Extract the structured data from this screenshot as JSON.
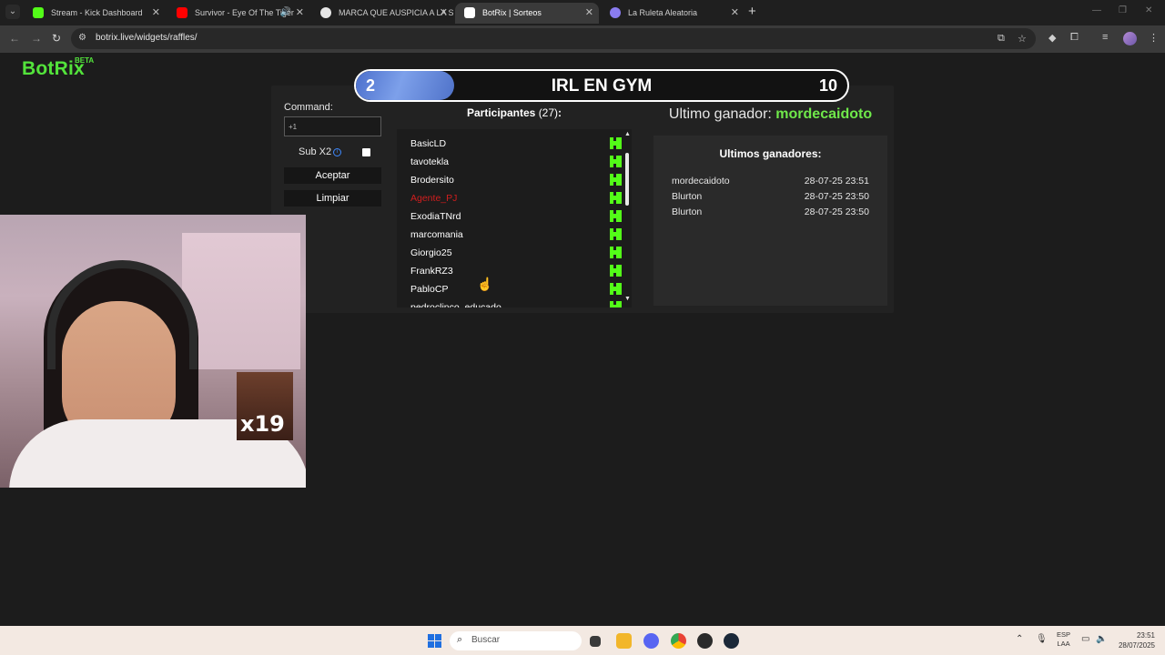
{
  "browser": {
    "tabs": [
      {
        "title": "Stream - Kick Dashboard",
        "favicon_color": "#53fc18",
        "active": false
      },
      {
        "title": "Survivor - Eye Of The Tiger",
        "favicon_color": "#ff0000",
        "active": false
      },
      {
        "title": "MARCA QUE AUSPICIA A LA SE",
        "favicon_color": "#e6e6e6",
        "active": false
      },
      {
        "title": "BotRix | Sorteos",
        "favicon_color": "#ffffff",
        "active": true
      },
      {
        "title": "La Ruleta Aleatoria",
        "favicon_color": "#8a7cf0",
        "active": false
      }
    ],
    "url": "botrix.live/widgets/raffles/"
  },
  "app": {
    "logo": "BotRix",
    "logo_badge": "BETA"
  },
  "raffle": {
    "progress_min": "2",
    "title": "IRL EN GYM",
    "progress_max": "10",
    "progress_fraction": 0.2
  },
  "controls": {
    "command_label": "Command:",
    "command_value": "+1",
    "sub_label": "Sub X2",
    "accept_label": "Aceptar",
    "clear_label": "Limpiar"
  },
  "participants": {
    "title": "Participantes",
    "count": "(27)",
    "suffix": ":",
    "items": [
      {
        "name": "BasicLD",
        "highlight": false
      },
      {
        "name": "tavotekla",
        "highlight": false
      },
      {
        "name": "Brodersito",
        "highlight": false
      },
      {
        "name": "Agente_PJ",
        "highlight": true
      },
      {
        "name": "ExodiaTNrd",
        "highlight": false
      },
      {
        "name": "marcomania",
        "highlight": false
      },
      {
        "name": "Giorgio25",
        "highlight": false
      },
      {
        "name": "FrankRZ3",
        "highlight": false
      },
      {
        "name": "PabloCP",
        "highlight": false
      },
      {
        "name": "pedroclinco_educado",
        "highlight": false
      }
    ]
  },
  "last_winner": {
    "label": "Ultimo ganador:",
    "name": "mordecaidoto"
  },
  "winners": {
    "title": "Ultimos ganadores:",
    "items": [
      {
        "name": "mordecaidoto",
        "date": "28-07-25 23:51"
      },
      {
        "name": "Blurton",
        "date": "28-07-25 23:50"
      },
      {
        "name": "Blurton",
        "date": "28-07-25 23:50"
      }
    ]
  },
  "overlay": {
    "multiplier": "x19"
  },
  "taskbar": {
    "search_placeholder": "Buscar",
    "lang_line1": "ESP",
    "lang_line2": "LAA",
    "time": "23:51",
    "date": "28/07/2025"
  }
}
